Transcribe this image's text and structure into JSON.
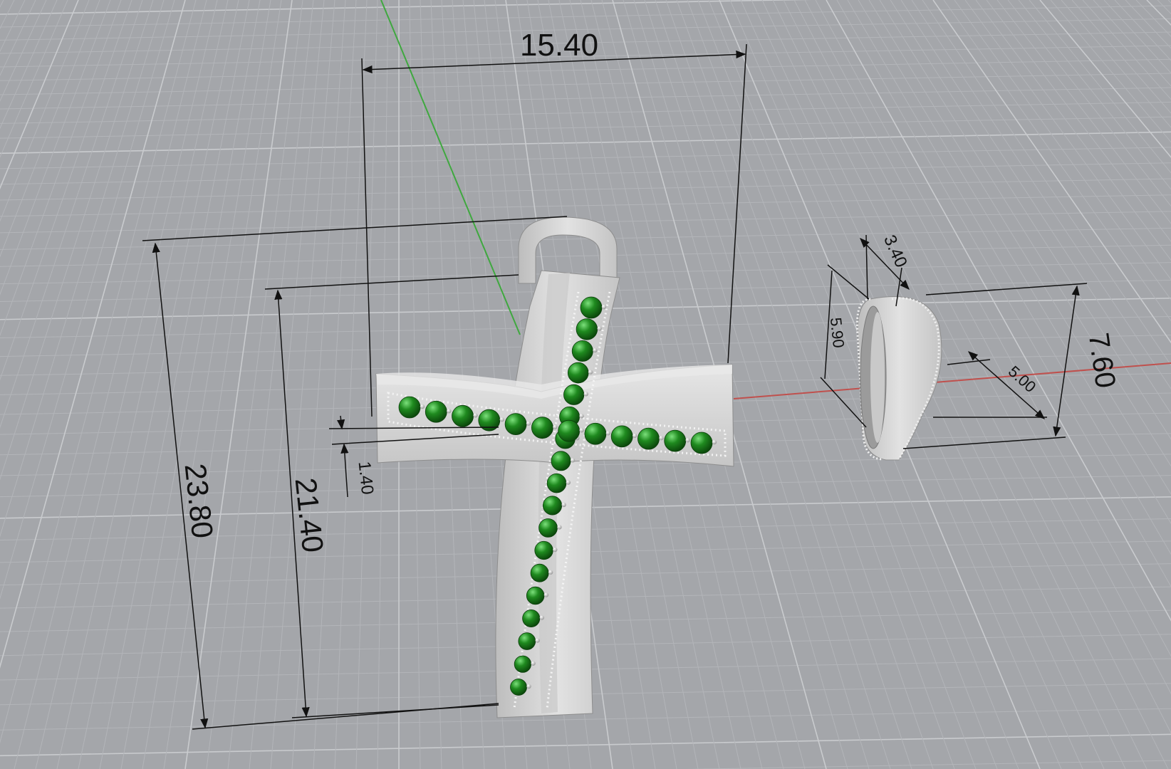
{
  "viewport": {
    "background": "#a4a6aa",
    "grid_minor_color": "#b3b5b9",
    "grid_major_color": "#c9cbce",
    "x_axis_color": "#c0504d",
    "y_axis_color": "#3fa83f",
    "metal_color": "#d2d2d2",
    "stone_color": "#1f8a1f",
    "dimension_color": "#111111"
  },
  "dimensions": {
    "cross_width": "15.40",
    "cross_height_total": "23.80",
    "cross_height_body": "21.40",
    "cross_thickness": "1.40",
    "bail_width": "3.40",
    "bail_height_inner": "5.90",
    "bail_height_outer": "7.60",
    "bail_depth": "5.00"
  },
  "objects": {
    "cross_stones_vertical": 18,
    "cross_stones_horizontal": 12
  }
}
